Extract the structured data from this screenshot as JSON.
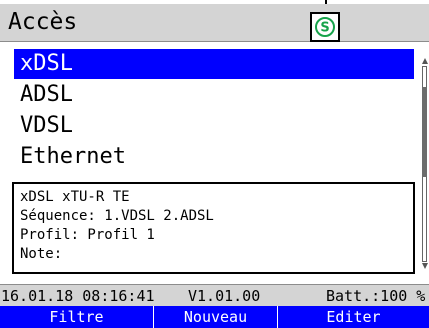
{
  "header": {
    "title": "Accès",
    "status_icon": {
      "name": "s-circle-icon",
      "glyph": "S",
      "color": "#16a34a"
    }
  },
  "menu": {
    "items": [
      {
        "label": "xDSL",
        "selected": true
      },
      {
        "label": "ADSL",
        "selected": false
      },
      {
        "label": "VDSL",
        "selected": false
      },
      {
        "label": "Ethernet",
        "selected": false
      }
    ]
  },
  "info": {
    "lines": [
      "xDSL xTU-R TE",
      "Séquence: 1.VDSL 2.ADSL",
      "Profil: Profil 1",
      "Note:"
    ]
  },
  "status": {
    "datetime": "16.01.18 08:16:41",
    "version": "V1.01.00",
    "battery": "Batt.:100 %"
  },
  "softkeys": {
    "left": "Filtre",
    "middle": "Nouveau",
    "right": "Editer"
  },
  "colors": {
    "selection": "#0000ff",
    "bar_background": "#d4d4d4",
    "softkey_background": "#0000ff"
  }
}
